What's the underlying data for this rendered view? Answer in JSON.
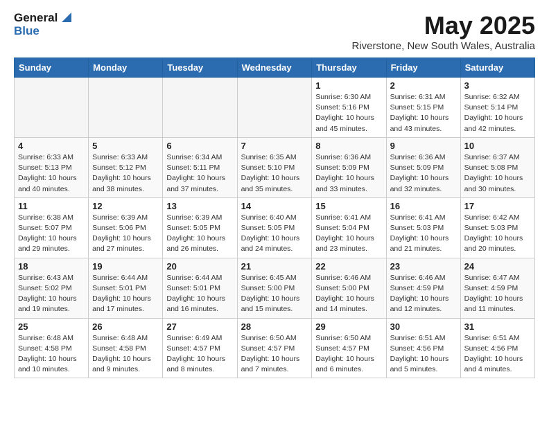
{
  "logo": {
    "line1": "General",
    "line2": "Blue"
  },
  "title": "May 2025",
  "subtitle": "Riverstone, New South Wales, Australia",
  "weekdays": [
    "Sunday",
    "Monday",
    "Tuesday",
    "Wednesday",
    "Thursday",
    "Friday",
    "Saturday"
  ],
  "weeks": [
    [
      {
        "day": "",
        "info": ""
      },
      {
        "day": "",
        "info": ""
      },
      {
        "day": "",
        "info": ""
      },
      {
        "day": "",
        "info": ""
      },
      {
        "day": "1",
        "info": "Sunrise: 6:30 AM\nSunset: 5:16 PM\nDaylight: 10 hours\nand 45 minutes."
      },
      {
        "day": "2",
        "info": "Sunrise: 6:31 AM\nSunset: 5:15 PM\nDaylight: 10 hours\nand 43 minutes."
      },
      {
        "day": "3",
        "info": "Sunrise: 6:32 AM\nSunset: 5:14 PM\nDaylight: 10 hours\nand 42 minutes."
      }
    ],
    [
      {
        "day": "4",
        "info": "Sunrise: 6:33 AM\nSunset: 5:13 PM\nDaylight: 10 hours\nand 40 minutes."
      },
      {
        "day": "5",
        "info": "Sunrise: 6:33 AM\nSunset: 5:12 PM\nDaylight: 10 hours\nand 38 minutes."
      },
      {
        "day": "6",
        "info": "Sunrise: 6:34 AM\nSunset: 5:11 PM\nDaylight: 10 hours\nand 37 minutes."
      },
      {
        "day": "7",
        "info": "Sunrise: 6:35 AM\nSunset: 5:10 PM\nDaylight: 10 hours\nand 35 minutes."
      },
      {
        "day": "8",
        "info": "Sunrise: 6:36 AM\nSunset: 5:09 PM\nDaylight: 10 hours\nand 33 minutes."
      },
      {
        "day": "9",
        "info": "Sunrise: 6:36 AM\nSunset: 5:09 PM\nDaylight: 10 hours\nand 32 minutes."
      },
      {
        "day": "10",
        "info": "Sunrise: 6:37 AM\nSunset: 5:08 PM\nDaylight: 10 hours\nand 30 minutes."
      }
    ],
    [
      {
        "day": "11",
        "info": "Sunrise: 6:38 AM\nSunset: 5:07 PM\nDaylight: 10 hours\nand 29 minutes."
      },
      {
        "day": "12",
        "info": "Sunrise: 6:39 AM\nSunset: 5:06 PM\nDaylight: 10 hours\nand 27 minutes."
      },
      {
        "day": "13",
        "info": "Sunrise: 6:39 AM\nSunset: 5:05 PM\nDaylight: 10 hours\nand 26 minutes."
      },
      {
        "day": "14",
        "info": "Sunrise: 6:40 AM\nSunset: 5:05 PM\nDaylight: 10 hours\nand 24 minutes."
      },
      {
        "day": "15",
        "info": "Sunrise: 6:41 AM\nSunset: 5:04 PM\nDaylight: 10 hours\nand 23 minutes."
      },
      {
        "day": "16",
        "info": "Sunrise: 6:41 AM\nSunset: 5:03 PM\nDaylight: 10 hours\nand 21 minutes."
      },
      {
        "day": "17",
        "info": "Sunrise: 6:42 AM\nSunset: 5:03 PM\nDaylight: 10 hours\nand 20 minutes."
      }
    ],
    [
      {
        "day": "18",
        "info": "Sunrise: 6:43 AM\nSunset: 5:02 PM\nDaylight: 10 hours\nand 19 minutes."
      },
      {
        "day": "19",
        "info": "Sunrise: 6:44 AM\nSunset: 5:01 PM\nDaylight: 10 hours\nand 17 minutes."
      },
      {
        "day": "20",
        "info": "Sunrise: 6:44 AM\nSunset: 5:01 PM\nDaylight: 10 hours\nand 16 minutes."
      },
      {
        "day": "21",
        "info": "Sunrise: 6:45 AM\nSunset: 5:00 PM\nDaylight: 10 hours\nand 15 minutes."
      },
      {
        "day": "22",
        "info": "Sunrise: 6:46 AM\nSunset: 5:00 PM\nDaylight: 10 hours\nand 14 minutes."
      },
      {
        "day": "23",
        "info": "Sunrise: 6:46 AM\nSunset: 4:59 PM\nDaylight: 10 hours\nand 12 minutes."
      },
      {
        "day": "24",
        "info": "Sunrise: 6:47 AM\nSunset: 4:59 PM\nDaylight: 10 hours\nand 11 minutes."
      }
    ],
    [
      {
        "day": "25",
        "info": "Sunrise: 6:48 AM\nSunset: 4:58 PM\nDaylight: 10 hours\nand 10 minutes."
      },
      {
        "day": "26",
        "info": "Sunrise: 6:48 AM\nSunset: 4:58 PM\nDaylight: 10 hours\nand 9 minutes."
      },
      {
        "day": "27",
        "info": "Sunrise: 6:49 AM\nSunset: 4:57 PM\nDaylight: 10 hours\nand 8 minutes."
      },
      {
        "day": "28",
        "info": "Sunrise: 6:50 AM\nSunset: 4:57 PM\nDaylight: 10 hours\nand 7 minutes."
      },
      {
        "day": "29",
        "info": "Sunrise: 6:50 AM\nSunset: 4:57 PM\nDaylight: 10 hours\nand 6 minutes."
      },
      {
        "day": "30",
        "info": "Sunrise: 6:51 AM\nSunset: 4:56 PM\nDaylight: 10 hours\nand 5 minutes."
      },
      {
        "day": "31",
        "info": "Sunrise: 6:51 AM\nSunset: 4:56 PM\nDaylight: 10 hours\nand 4 minutes."
      }
    ]
  ]
}
